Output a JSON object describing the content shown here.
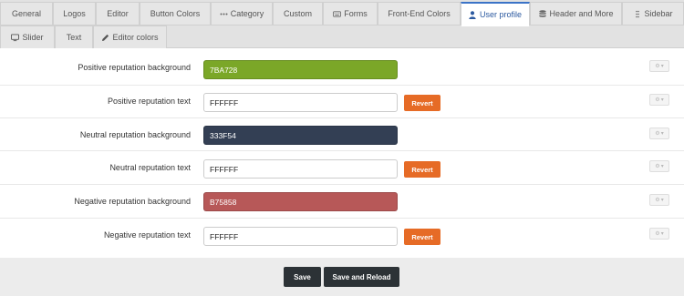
{
  "tabs_row1": [
    {
      "label": "General",
      "icon": ""
    },
    {
      "label": "Logos",
      "icon": ""
    },
    {
      "label": "Editor",
      "icon": ""
    },
    {
      "label": "Button Colors",
      "icon": ""
    },
    {
      "label": "Category",
      "icon": "ellipsis-icon"
    },
    {
      "label": "Custom",
      "icon": ""
    },
    {
      "label": "Forms",
      "icon": "keyboard-icon"
    },
    {
      "label": "Front-End Colors",
      "icon": ""
    },
    {
      "label": "User profile",
      "icon": "user-icon",
      "active": true
    },
    {
      "label": "Header and More",
      "icon": "database-icon"
    },
    {
      "label": "Sidebar",
      "icon": "grip-icon"
    }
  ],
  "tabs_row2": [
    {
      "label": "Slider",
      "icon": "monitor-icon"
    },
    {
      "label": "Text",
      "icon": ""
    },
    {
      "label": "Editor colors",
      "icon": "pencil-icon"
    }
  ],
  "settings": [
    {
      "label": "Positive reputation background",
      "value": "7BA728",
      "swatch": "#7BA728",
      "revert": ""
    },
    {
      "label": "Positive reputation text",
      "value": "FFFFFF",
      "swatch": "",
      "revert": "Revert"
    },
    {
      "label": "Neutral reputation background",
      "value": "333F54",
      "swatch": "#333F54",
      "revert": ""
    },
    {
      "label": "Neutral reputation text",
      "value": "FFFFFF",
      "swatch": "",
      "revert": "Revert"
    },
    {
      "label": "Negative reputation background",
      "value": "B75858",
      "swatch": "#B75858",
      "revert": ""
    },
    {
      "label": "Negative reputation text",
      "value": "FFFFFF",
      "swatch": "",
      "revert": "Revert"
    }
  ],
  "footer": {
    "save_label": "Save",
    "save_reload_label": "Save and Reload"
  },
  "colors": {
    "accent_tab": "#3B73C7",
    "revert": "#E66B26",
    "footer_button": "#2C3236"
  }
}
